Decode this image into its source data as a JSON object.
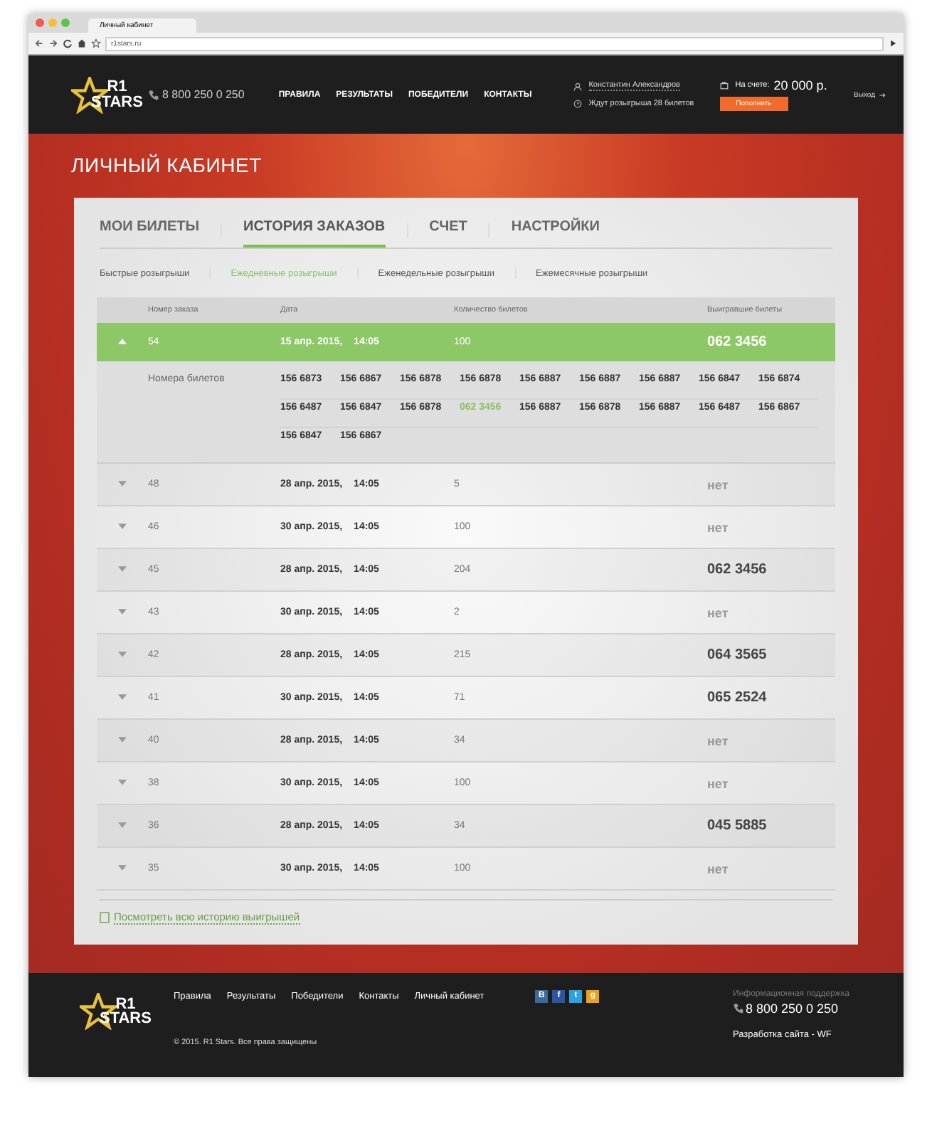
{
  "browser": {
    "tab_title": "Личный кабинет",
    "url": "r1stars.ru"
  },
  "header": {
    "logo_top": "R1",
    "logo_bottom": "STARS",
    "phone": "8 800 250 0 250",
    "nav": [
      "ПРАВИЛА",
      "РЕЗУЛЬТАТЫ",
      "ПОБЕДИТЕЛИ",
      "КОНТАКТЫ"
    ],
    "user_name": "Константин Александров",
    "waiting": "Ждут розыгрыша 28 билетов",
    "balance_label": "На счете:",
    "balance": "20 000 р.",
    "topup_button": "Пополнить",
    "logout": "Выход"
  },
  "page_title": "ЛИЧНЫЙ КАБИНЕТ",
  "tabs": [
    {
      "label": "МОИ БИЛЕТЫ",
      "selected": false
    },
    {
      "label": "ИСТОРИЯ ЗАКАЗОВ",
      "selected": true
    },
    {
      "label": "СЧЕТ",
      "selected": false
    },
    {
      "label": "НАСТРОЙКИ",
      "selected": false
    }
  ],
  "subtabs": [
    {
      "label": "Быстрые розыгрыши",
      "selected": false
    },
    {
      "label": "Ежедневные розыгрыши",
      "selected": true
    },
    {
      "label": "Еженедельные розыгрыши",
      "selected": false
    },
    {
      "label": "Ежемесячные розыгрыши",
      "selected": false
    }
  ],
  "table": {
    "columns": [
      "Номер заказа",
      "Дата",
      "Количество билетов",
      "Выигравшие билеты"
    ],
    "tickets_label": "Номера билетов",
    "rows": [
      {
        "number": "54",
        "date": "15 апр. 2015,",
        "time": "14:05",
        "count": "100",
        "win": "062 3456",
        "won": true,
        "expanded": true,
        "tickets": [
          {
            "n": "156 6873",
            "winning": false
          },
          {
            "n": "156 6867",
            "winning": false
          },
          {
            "n": "156 6878",
            "winning": false
          },
          {
            "n": "156 6878",
            "winning": false
          },
          {
            "n": "156 6887",
            "winning": false
          },
          {
            "n": "156 6887",
            "winning": false
          },
          {
            "n": "156 6887",
            "winning": false
          },
          {
            "n": "156 6847",
            "winning": false
          },
          {
            "n": "156 6874",
            "winning": false
          },
          {
            "n": "156 6487",
            "winning": false
          },
          {
            "n": "156 6847",
            "winning": false
          },
          {
            "n": "156 6878",
            "winning": false
          },
          {
            "n": "062 3456",
            "winning": true
          },
          {
            "n": "156 6887",
            "winning": false
          },
          {
            "n": "156 6878",
            "winning": false
          },
          {
            "n": "156 6887",
            "winning": false
          },
          {
            "n": "156 6487",
            "winning": false
          },
          {
            "n": "156 6867",
            "winning": false
          },
          {
            "n": "156 6847",
            "winning": false
          },
          {
            "n": "156 6867",
            "winning": false
          }
        ]
      },
      {
        "number": "48",
        "date": "28 апр. 2015,",
        "time": "14:05",
        "count": "5",
        "win": "нет",
        "won": false,
        "expanded": false
      },
      {
        "number": "46",
        "date": "30 апр. 2015,",
        "time": "14:05",
        "count": "100",
        "win": "нет",
        "won": false,
        "expanded": false
      },
      {
        "number": "45",
        "date": "28 апр. 2015,",
        "time": "14:05",
        "count": "204",
        "win": "062 3456",
        "won": true,
        "expanded": false
      },
      {
        "number": "43",
        "date": "30 апр. 2015,",
        "time": "14:05",
        "count": "2",
        "win": "нет",
        "won": false,
        "expanded": false
      },
      {
        "number": "42",
        "date": "28 апр. 2015,",
        "time": "14:05",
        "count": "215",
        "win": "064 3565",
        "won": true,
        "expanded": false
      },
      {
        "number": "41",
        "date": "30 апр. 2015,",
        "time": "14:05",
        "count": "71",
        "win": "065 2524",
        "won": true,
        "expanded": false
      },
      {
        "number": "40",
        "date": "28 апр. 2015,",
        "time": "14:05",
        "count": "34",
        "win": "нет",
        "won": false,
        "expanded": false
      },
      {
        "number": "38",
        "date": "30 апр. 2015,",
        "time": "14:05",
        "count": "100",
        "win": "нет",
        "won": false,
        "expanded": false
      },
      {
        "number": "36",
        "date": "28 апр. 2015,",
        "time": "14:05",
        "count": "34",
        "win": "045 5885",
        "won": true,
        "expanded": false
      },
      {
        "number": "35",
        "date": "30 апр. 2015,",
        "time": "14:05",
        "count": "100",
        "win": "нет",
        "won": false,
        "expanded": false
      }
    ]
  },
  "history_link": "Посмотреть всю историю выигрышей",
  "footer": {
    "logo_top": "R1",
    "logo_bottom": "STARS",
    "links": [
      "Правила",
      "Результаты",
      "Победители",
      "Контакты",
      "Личный кабинет"
    ],
    "social": [
      {
        "letter": "В",
        "color": "#3b6b9a"
      },
      {
        "letter": "f",
        "color": "#2e55a4"
      },
      {
        "letter": "t",
        "color": "#2aa3e0"
      },
      {
        "letter": "g",
        "color": "#e9a21a"
      }
    ],
    "copyright": "© 2015. R1 Stars. Все права защищены",
    "support_label": "Информационная поддержка",
    "phone": "8 800 250 0 250",
    "developer": "Разработка сайта - WF"
  }
}
